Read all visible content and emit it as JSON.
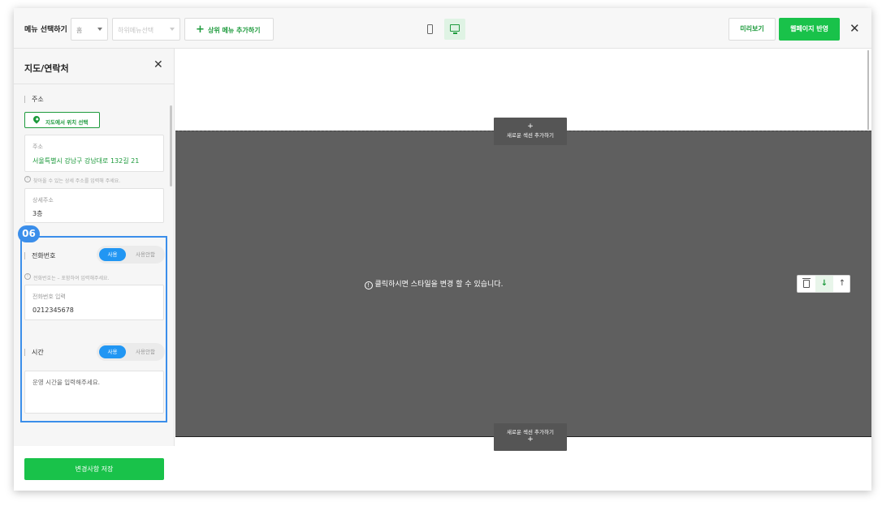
{
  "topbar": {
    "menu_select_label": "메뉴 선택하기",
    "menu_select_value": "홈",
    "submenu_select_placeholder": "하위메뉴선택",
    "add_top_menu_label": "상위 메뉴 추가하기",
    "preview_label": "미리보기",
    "publish_label": "웹페이지 반영",
    "close_icon": "close-icon",
    "accent_color": "#19c24a"
  },
  "panel": {
    "title": "지도/연락처",
    "address_section_label": "주소",
    "map_select_button": "지도에서 위치 선택",
    "address_field_label": "주소",
    "address_value": "서울특별시 강남구 강남대로 132길 21",
    "address_hint": "찾아올 수 있는 상세 주소를 입력해 주세요.",
    "detail_field_label": "상세주소",
    "detail_value": "3층",
    "step_badge": "06",
    "phone_section_label": "전화번호",
    "phone_toggle_on": "사용",
    "phone_toggle_off": "사용안함",
    "phone_hint": "전화번호는 – 포함하여 입력해주세요.",
    "phone_field_label": "전화번호 입력",
    "phone_value": "0212345678",
    "hours_section_label": "시간",
    "hours_toggle_on": "사용",
    "hours_toggle_off": "사용안함",
    "hours_placeholder": "운영 시간을 입력해주세요.",
    "save_button": "변경사항 저장"
  },
  "canvas": {
    "add_section_top": "새로운 섹션 추가하기",
    "add_section_bottom": "새로운 섹션 추가하기",
    "plus_symbol": "+",
    "center_message": "클릭하시면 스타일을 변경 할 수 있습니다.",
    "tools": [
      "trash-icon",
      "arrow-down-icon",
      "arrow-up-icon"
    ]
  }
}
